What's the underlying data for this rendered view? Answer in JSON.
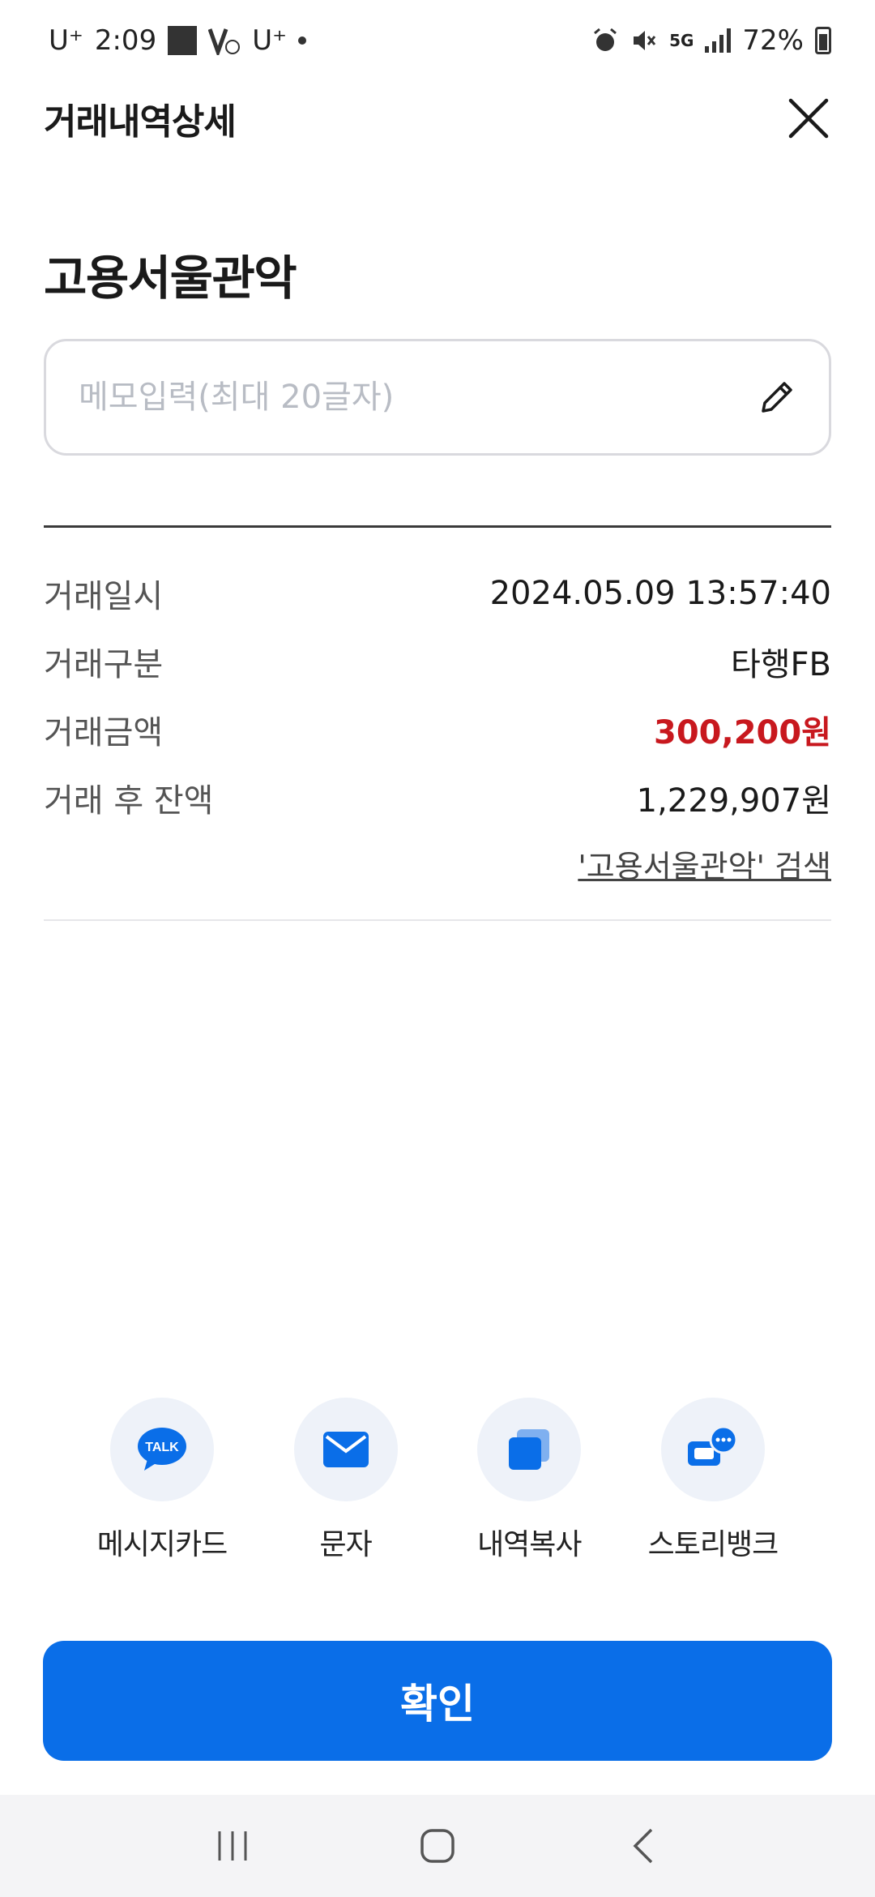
{
  "status_bar": {
    "carrier_left": "U⁺",
    "time": "2:09",
    "carrier_right": "U⁺",
    "network": "5G",
    "battery_text": "72%"
  },
  "header": {
    "title": "거래내역상세",
    "close_icon": "close-icon"
  },
  "merchant_name": "고용서울관악",
  "memo": {
    "value": "",
    "placeholder": "메모입력(최대 20글자)",
    "icon": "pencil-icon"
  },
  "details": [
    {
      "label": "거래일시",
      "value": "2024.05.09  13:57:40"
    },
    {
      "label": "거래구분",
      "value": "타행FB"
    },
    {
      "label": "거래금액",
      "value": "300,200원"
    },
    {
      "label": "거래 후 잔액",
      "value": "1,229,907원"
    }
  ],
  "search_link": "'고용서울관악' 검색",
  "actions": [
    {
      "label": "메시지카드",
      "icon": "kakaotalk-icon"
    },
    {
      "label": "문자",
      "icon": "mail-icon"
    },
    {
      "label": "내역복사",
      "icon": "copy-icon"
    },
    {
      "label": "스토리뱅크",
      "icon": "chat-bubbles-icon"
    }
  ],
  "kakao_badge": "TALK",
  "confirm_label": "확인",
  "colors": {
    "accent": "#0a6ee8",
    "amount": "#c8181e",
    "action_bg": "#eef2f9"
  }
}
